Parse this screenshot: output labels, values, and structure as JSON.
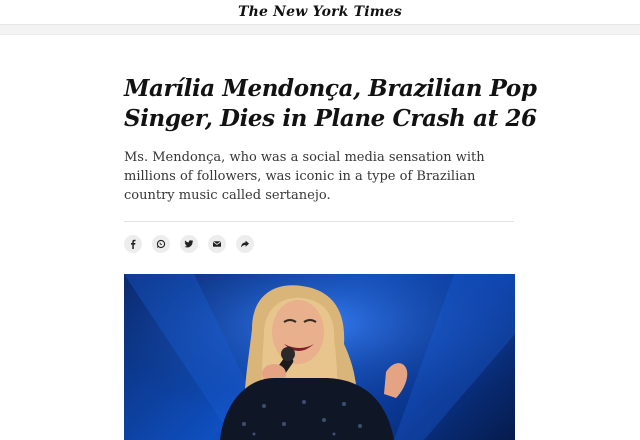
{
  "masthead": {
    "logo_text": "The New York Times"
  },
  "article": {
    "headline": "Marília Mendonça, Brazilian Pop Singer, Dies in Plane Crash at 26",
    "summary": "Ms. Mendonça, who was a social media sensation with millions of followers, was iconic in a type of Brazilian country music called sertanejo."
  },
  "share": [
    {
      "icon": "facebook-icon"
    },
    {
      "icon": "whatsapp-icon"
    },
    {
      "icon": "twitter-icon"
    },
    {
      "icon": "email-icon"
    },
    {
      "icon": "share-arrow-icon"
    }
  ],
  "colors": {
    "text": "#121212",
    "summary": "#363636",
    "photo_blue": "#0f4fbf",
    "icon_bg": "#ededed"
  }
}
